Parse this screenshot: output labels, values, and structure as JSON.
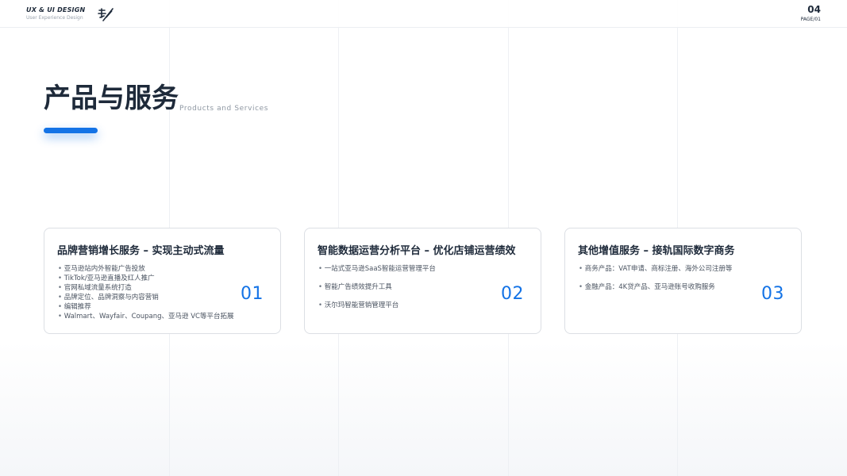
{
  "header": {
    "brand_title": "UX & UI DESIGN",
    "brand_subtitle": "User Experience Design",
    "page_number": "04",
    "page_label": "PAGE/01"
  },
  "title": {
    "main": "产品与服务",
    "sub": "Products and Services"
  },
  "colors": {
    "accent": "#1473e6",
    "text_dark": "#1e2a3a",
    "card_border": "#dcdfe4"
  },
  "cards": [
    {
      "title": "品牌营销增长服务 – 实现主动式流量",
      "number": "01",
      "items": [
        "亚马逊站内外智能广告投放",
        "TikTok/亚马逊直播及红人推广",
        "官网私域流量系统打造",
        "品牌定位、品牌洞察与内容营销",
        "编辑推荐",
        "Walmart、Wayfair、Coupang、亚马逊 VC等平台拓展"
      ]
    },
    {
      "title": "智能数据运营分析平台 – 优化店铺运营绩效",
      "number": "02",
      "items": [
        "一站式亚马逊SaaS智能运营管理平台",
        "智能广告绩效提升工具",
        "沃尔玛智能营销管理平台"
      ]
    },
    {
      "title": "其他增值服务 – 接轨国际数字商务",
      "number": "03",
      "items": [
        "商务产品：VAT申请、商标注册、海外公司注册等",
        "金融产品：4K贷产品、亚马逊账号收购服务"
      ]
    }
  ]
}
